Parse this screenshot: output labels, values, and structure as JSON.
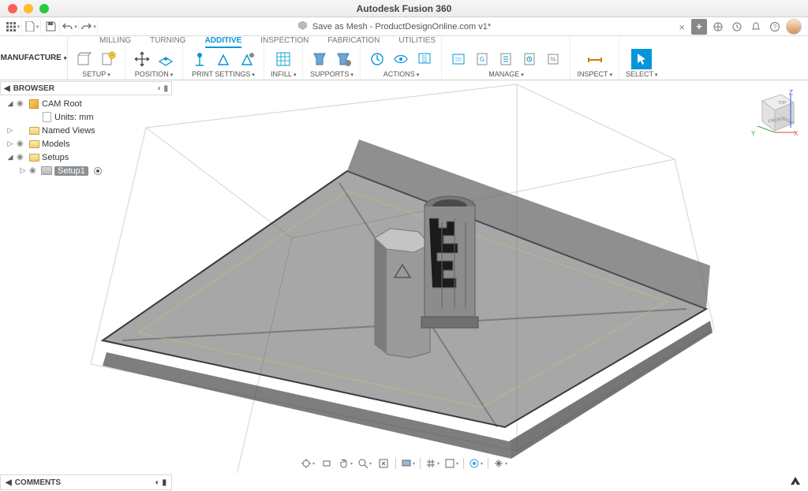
{
  "window": {
    "title": "Autodesk Fusion 360"
  },
  "document": {
    "icon": "cube",
    "name": "Save as Mesh - ProductDesignOnline.com v1*"
  },
  "qat": {
    "items": [
      "grid-menu",
      "file",
      "save",
      "undo",
      "redo"
    ]
  },
  "headerIcons": [
    "new-tab",
    "extensions",
    "notifications",
    "job-status",
    "help",
    "avatar"
  ],
  "workspace": {
    "label": "MANUFACTURE"
  },
  "ribbonTabs": [
    {
      "label": "MILLING",
      "active": false
    },
    {
      "label": "TURNING",
      "active": false
    },
    {
      "label": "ADDITIVE",
      "active": true
    },
    {
      "label": "INSPECTION",
      "active": false
    },
    {
      "label": "FABRICATION",
      "active": false
    },
    {
      "label": "UTILITIES",
      "active": false
    }
  ],
  "ribbonGroups": [
    {
      "label": "SETUP",
      "drop": true,
      "icons": [
        "new-setup",
        "folder"
      ]
    },
    {
      "label": "POSITION",
      "drop": true,
      "icons": [
        "move",
        "arrange"
      ]
    },
    {
      "label": "PRINT SETTINGS",
      "drop": true,
      "icons": [
        "print-setting-1",
        "print-setting-2",
        "print-setting-3"
      ]
    },
    {
      "label": "INFILL",
      "drop": true,
      "icons": [
        "infill"
      ]
    },
    {
      "label": "SUPPORTS",
      "drop": true,
      "icons": [
        "support-bar",
        "support-volume"
      ]
    },
    {
      "label": "ACTIONS",
      "drop": true,
      "icons": [
        "generate",
        "simulate",
        "post-process"
      ]
    },
    {
      "label": "MANAGE",
      "drop": true,
      "icons": [
        "machine-library",
        "tool-library",
        "template-library",
        "task-manager",
        "addins"
      ]
    },
    {
      "label": "INSPECT",
      "drop": true,
      "icons": [
        "measure"
      ]
    },
    {
      "label": "SELECT",
      "drop": true,
      "icons": [
        "select-arrow"
      ]
    }
  ],
  "browser": {
    "title": "BROWSER",
    "tree": [
      {
        "level": 0,
        "exp": "▢",
        "eye": true,
        "icon": "cube",
        "label": "CAM Root"
      },
      {
        "level": 1,
        "exp": "",
        "eye": false,
        "icon": "doc",
        "label": "Units: mm"
      },
      {
        "level": 0,
        "exp": "▷",
        "eye": false,
        "icon": "folder",
        "label": "Named Views"
      },
      {
        "level": 0,
        "exp": "▷",
        "eye": true,
        "icon": "folder",
        "label": "Models"
      },
      {
        "level": 0,
        "exp": "▢",
        "eye": true,
        "icon": "folder",
        "label": "Setups"
      },
      {
        "level": 1,
        "exp": "▷",
        "eye": true,
        "icon": "folder-open",
        "label": "Setup1",
        "selected": true,
        "radio": true
      }
    ]
  },
  "viewcube": {
    "front": "FRONT",
    "top": "TOP",
    "right": "RIGHT",
    "axes": [
      "X",
      "Y",
      "Z"
    ]
  },
  "navbar": [
    "orbit",
    "look-at",
    "pan",
    "zoom",
    "fit",
    "sep",
    "display",
    "sep",
    "grid",
    "snap",
    "sep",
    "viewports",
    "sep",
    "effects"
  ],
  "comments": {
    "label": "COMMENTS"
  }
}
